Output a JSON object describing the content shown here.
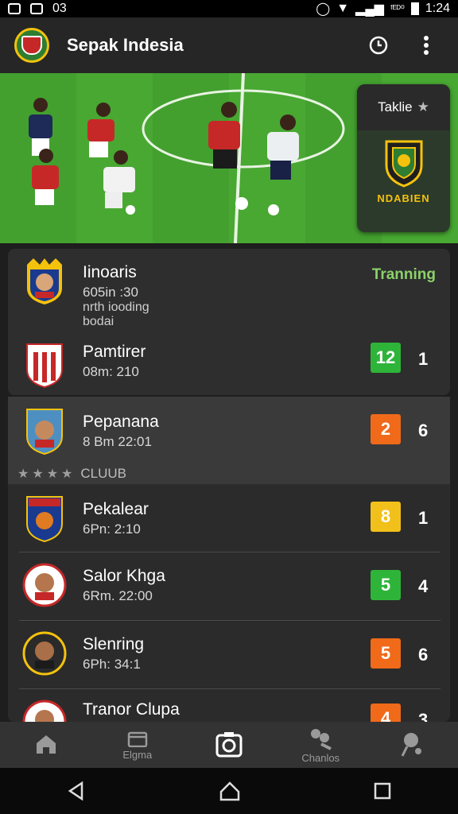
{
  "status_bar": {
    "left_text": "03",
    "right_text": "ᶠᴱᴰ⁰",
    "time": "1:24"
  },
  "app": {
    "title": "Sepak Indesia"
  },
  "feature": {
    "title": "Taklie",
    "label": "NDABIEN"
  },
  "matches_top": [
    {
      "name": "Iinoaris",
      "time": "605in :30",
      "extra1": "nrth iooding",
      "extra2": "bodai",
      "tag": "Tranning"
    },
    {
      "name": "Pamtirer",
      "time": "08m: 210",
      "badge": "12",
      "badge_color": "#2fb43a",
      "rank": "1"
    }
  ],
  "highlight_match": {
    "name": "Pepanana",
    "time": "8 Bm 22:01",
    "badge": "2",
    "badge_color": "#f06a1a",
    "rank": "6"
  },
  "club_label": "CLUUB",
  "club_matches": [
    {
      "name": "Pekalear",
      "time": "6Pn: 2:10",
      "badge": "8",
      "badge_color": "#f2c01a",
      "rank": "1"
    },
    {
      "name": "Salor Khga",
      "time": "6Rm. 22:00",
      "badge": "5",
      "badge_color": "#2fb43a",
      "rank": "4"
    },
    {
      "name": "Slenring",
      "time": "6Ph: 34:1",
      "badge": "5",
      "badge_color": "#f06a1a",
      "rank": "6"
    },
    {
      "name": "Tranor Clupa",
      "time": "",
      "badge": "4",
      "badge_color": "#f06a1a",
      "rank": "3"
    }
  ],
  "bottom_nav": [
    {
      "label": "",
      "icon": "home-icon"
    },
    {
      "label": "Elgma",
      "icon": "calendar-icon"
    },
    {
      "label": "",
      "icon": "camera-icon"
    },
    {
      "label": "Chanlos",
      "icon": "players-icon"
    },
    {
      "label": "",
      "icon": "whistle-icon"
    }
  ]
}
